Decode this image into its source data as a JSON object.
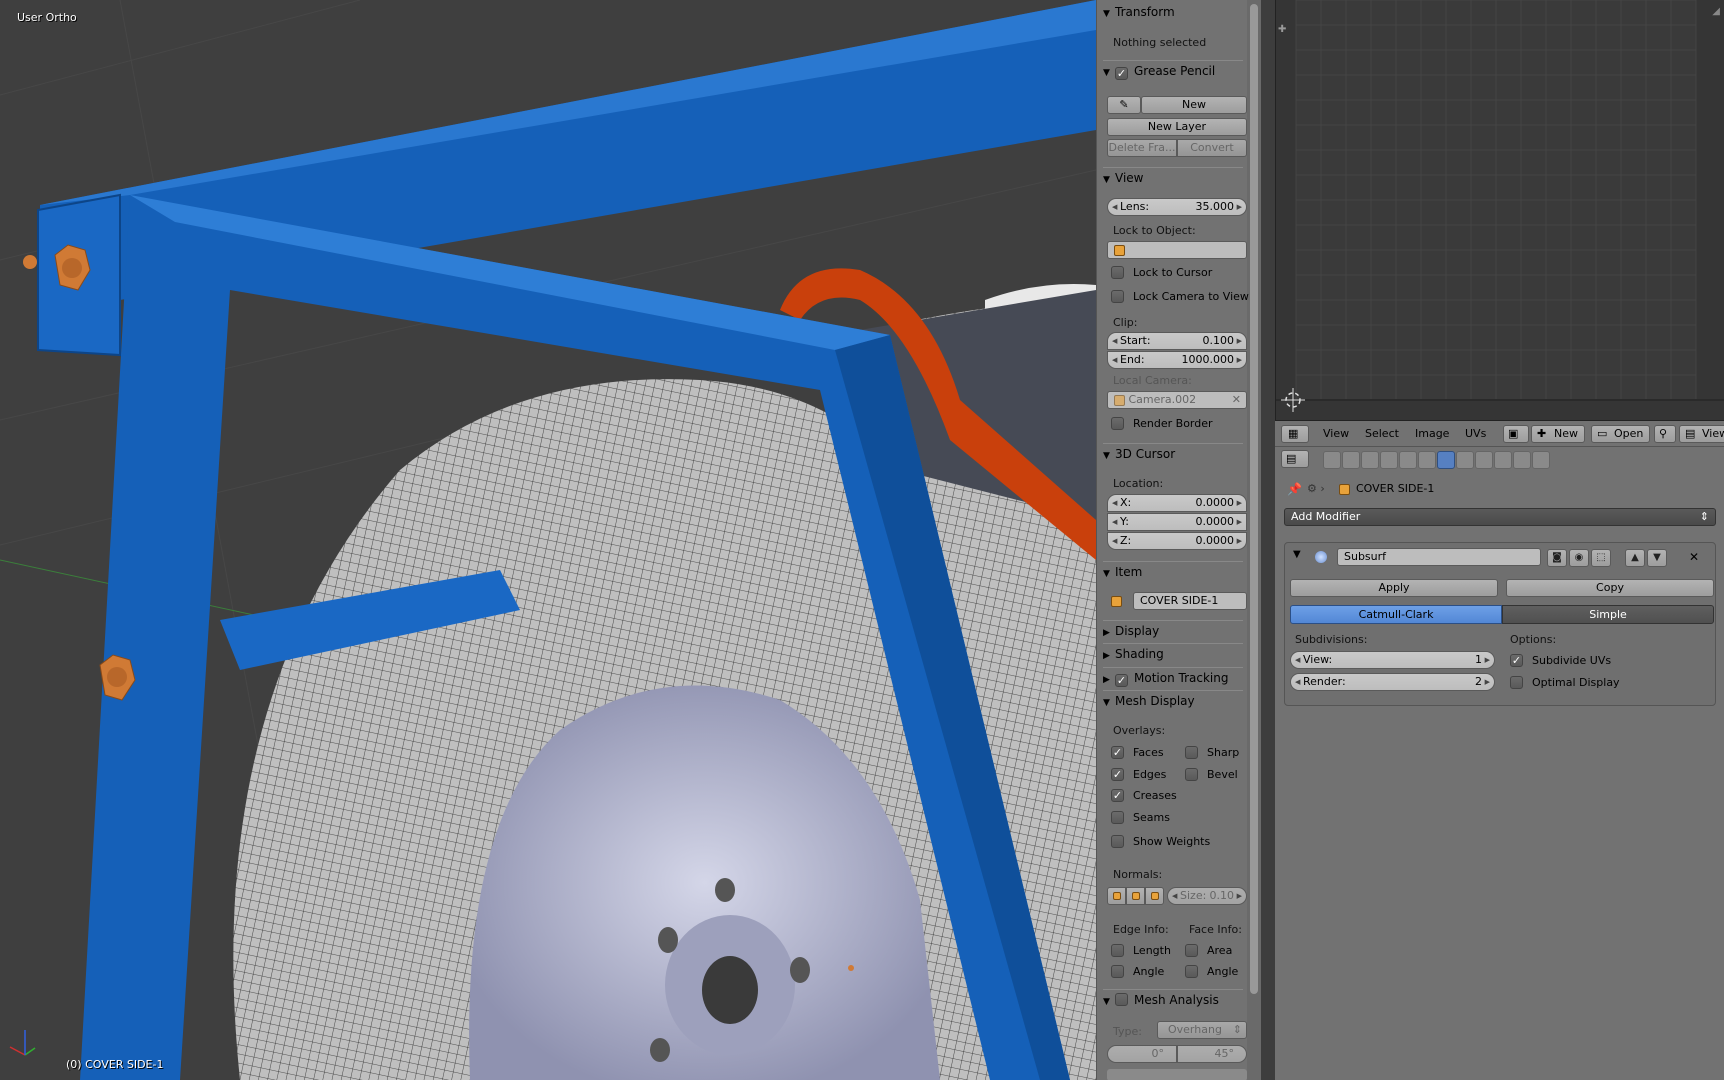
{
  "viewport": {
    "title": "User Ortho",
    "object_label": "(0) COVER SIDE-1"
  },
  "npanel": {
    "transform": {
      "header": "Transform",
      "status": "Nothing selected"
    },
    "grease_pencil": {
      "header": "Grease Pencil",
      "enabled": true,
      "new_label": "New",
      "new_layer_label": "New Layer",
      "delete_frame_label": "Delete Fra...",
      "convert_label": "Convert"
    },
    "view": {
      "header": "View",
      "lens_label": "Lens:",
      "lens_value": "35.000",
      "lock_to_object_label": "Lock to Object:",
      "lock_to_cursor_label": "Lock to Cursor",
      "lock_camera_label": "Lock Camera to View",
      "clip_label": "Clip:",
      "start_label": "Start:",
      "start_value": "0.100",
      "end_label": "End:",
      "end_value": "1000.000",
      "local_camera_label": "Local Camera:",
      "local_camera_value": "Camera.002",
      "render_border_label": "Render Border"
    },
    "cursor": {
      "header": "3D Cursor",
      "location_label": "Location:",
      "x_label": "X:",
      "x_value": "0.0000",
      "y_label": "Y:",
      "y_value": "0.0000",
      "z_label": "Z:",
      "z_value": "0.0000"
    },
    "item": {
      "header": "Item",
      "name": "COVER SIDE-1"
    },
    "display": {
      "header": "Display"
    },
    "shading": {
      "header": "Shading"
    },
    "motion_tracking": {
      "header": "Motion Tracking",
      "enabled": true
    },
    "mesh_display": {
      "header": "Mesh Display",
      "overlays_label": "Overlays:",
      "faces": "Faces",
      "sharp": "Sharp",
      "edges": "Edges",
      "bevel": "Bevel",
      "creases": "Creases",
      "seams": "Seams",
      "show_weights": "Show Weights",
      "normals_label": "Normals:",
      "size_label": "Size:",
      "size_value": "0.10",
      "edge_info_label": "Edge Info:",
      "face_info_label": "Face Info:",
      "length": "Length",
      "area": "Area",
      "angle": "Angle",
      "face_angle": "Angle"
    },
    "mesh_analysis": {
      "header": "Mesh Analysis",
      "type_label": "Type:",
      "type_value": "Overhang",
      "min_value": "0°",
      "max_value": "45°"
    }
  },
  "uv_header": {
    "view": "View",
    "select": "Select",
    "image": "Image",
    "uvs": "UVs",
    "new": "New",
    "open": "Open",
    "view_right": "View"
  },
  "properties": {
    "breadcrumb_object": "COVER SIDE-1",
    "add_modifier": "Add Modifier",
    "modifier": {
      "name": "Subsurf",
      "apply": "Apply",
      "copy": "Copy",
      "catmull_clark": "Catmull-Clark",
      "simple": "Simple",
      "subdivisions_label": "Subdivisions:",
      "view_label": "View:",
      "view_value": "1",
      "render_label": "Render:",
      "render_value": "2",
      "options_label": "Options:",
      "subdivide_uvs": "Subdivide UVs",
      "optimal_display": "Optimal Display"
    }
  },
  "colors": {
    "frame_blue": "#1560b8",
    "strap_orange": "#c9400c",
    "bolt_orange": "#d07a35",
    "panel_gray": "#727272",
    "accent_blue": "#5287d6"
  }
}
